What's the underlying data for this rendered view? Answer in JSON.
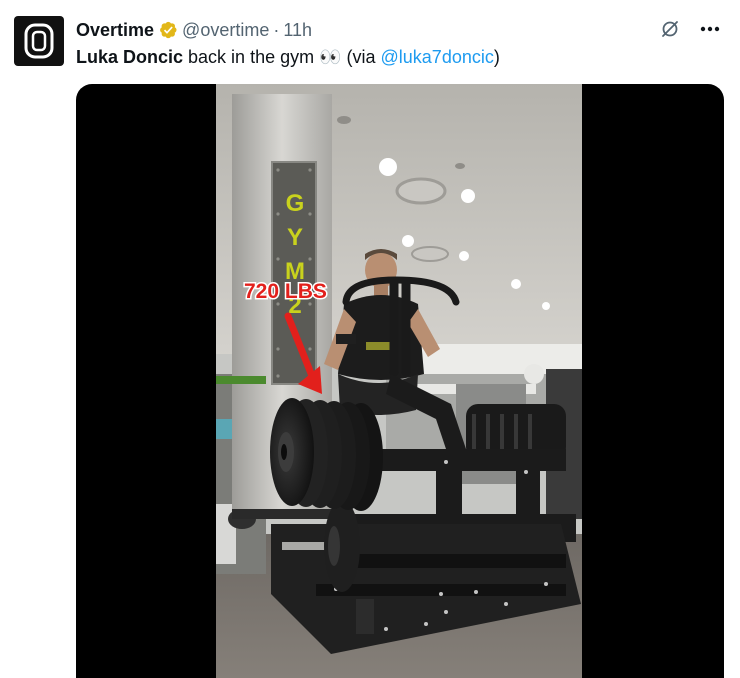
{
  "author": {
    "display_name": "Overtime",
    "handle": "@overtime",
    "separator": "·",
    "time": "11h"
  },
  "tweet": {
    "bold_name": "Luka Doncic",
    "text_middle": " back in the gym 👀 (via ",
    "mention": "@luka7doncic",
    "text_end": ")"
  },
  "video": {
    "overlay_label": "720 LBS",
    "sign_text": "GYM 2"
  },
  "colors": {
    "link": "#1d9bf0",
    "verified": "#e2b719",
    "secondary_text": "#536471",
    "overlay_red": "#e2201c"
  },
  "icons": {
    "grok": "grok-icon",
    "more": "more-icon",
    "verified": "verified-badge-icon"
  }
}
